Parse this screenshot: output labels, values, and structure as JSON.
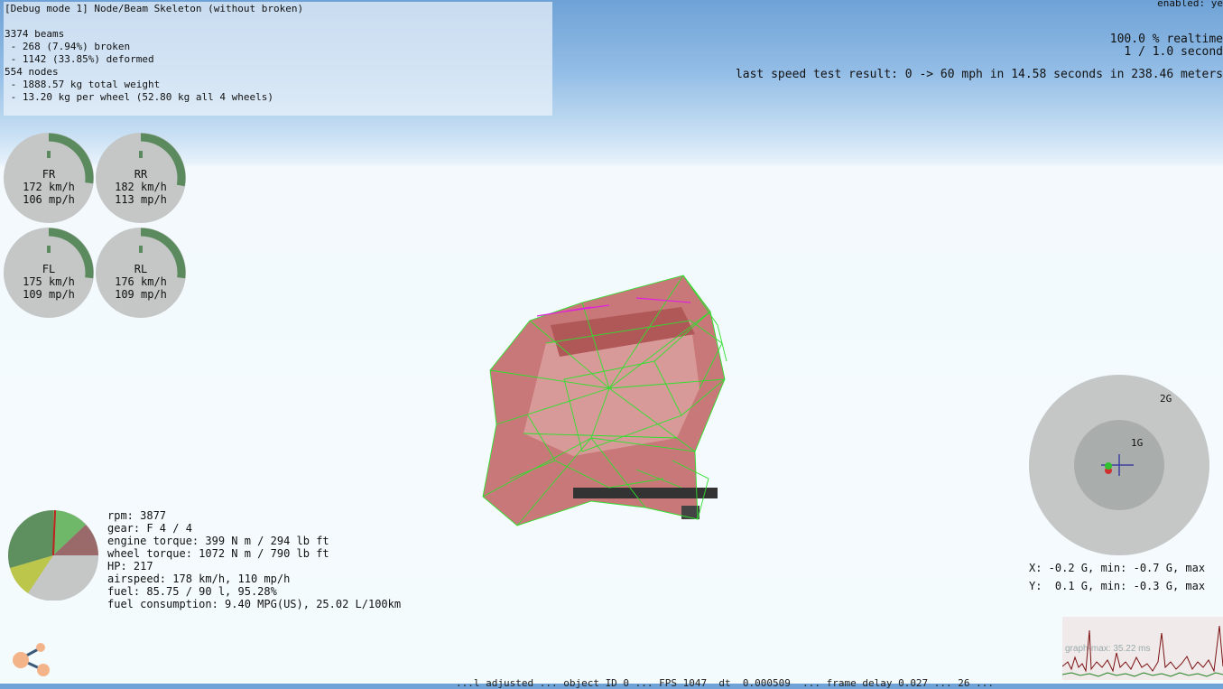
{
  "debug": {
    "mode_line": "[Debug mode 1] Node/Beam Skeleton (without broken)",
    "beams": "3374 beams",
    "broken": " - 268 (7.94%) broken",
    "deformed": " - 1142 (33.85%) deformed",
    "nodes": "554 nodes",
    "total_weight": " - 1888.57 kg total weight",
    "per_wheel": " - 13.20 kg per wheel (52.80 kg all 4 wheels)"
  },
  "top_right": {
    "enabled": "enabled: ye",
    "realtime": "100.0 % realtime",
    "seconds": "1 / 1.0 second",
    "speed_test": "last speed test result: 0 -> 60 mph in 14.58 seconds in 238.46 meters"
  },
  "wheels": [
    {
      "name": "FR",
      "kmh": "172 km/h",
      "mph": "106 mp/h",
      "fill": 0.27
    },
    {
      "name": "RR",
      "kmh": "182 km/h",
      "mph": "113 mp/h",
      "fill": 0.28
    },
    {
      "name": "FL",
      "kmh": "175 km/h",
      "mph": "109 mp/h",
      "fill": 0.27
    },
    {
      "name": "RL",
      "kmh": "176 km/h",
      "mph": "109 mp/h",
      "fill": 0.27
    }
  ],
  "engine": {
    "rpm": "rpm: 3877",
    "gear": "gear: F 4 / 4",
    "engine_torque": "engine torque: 399 N m / 294 lb ft",
    "wheel_torque": "wheel torque: 1072 N m / 790 lb ft",
    "hp": "HP: 217",
    "airspeed": "airspeed: 178 km/h, 110 mp/h",
    "fuel": "fuel: 85.75 / 90 l, 95.28%",
    "consumption": "fuel consumption: 9.40 MPG(US), 25.02 L/100km"
  },
  "gforce": {
    "ring_outer_label": "2G",
    "ring_inner_label": "1G",
    "x_line": "X: -0.2 G, min: -0.7 G, max",
    "y_line": "Y:  0.1 G, min: -0.3 G, max"
  },
  "graph": {
    "label": "graph-max: 35.22 ms"
  },
  "bottom_status": "...l adjusted ... object ID 0 ... FPS 1047  dt  0.000509  ... frame delay 0.027 ... 26 ...",
  "colors": {
    "gauge_bg": "#c4c7c6",
    "gauge_arc": "#5b8a5e",
    "skeleton": "#2ee02e"
  }
}
